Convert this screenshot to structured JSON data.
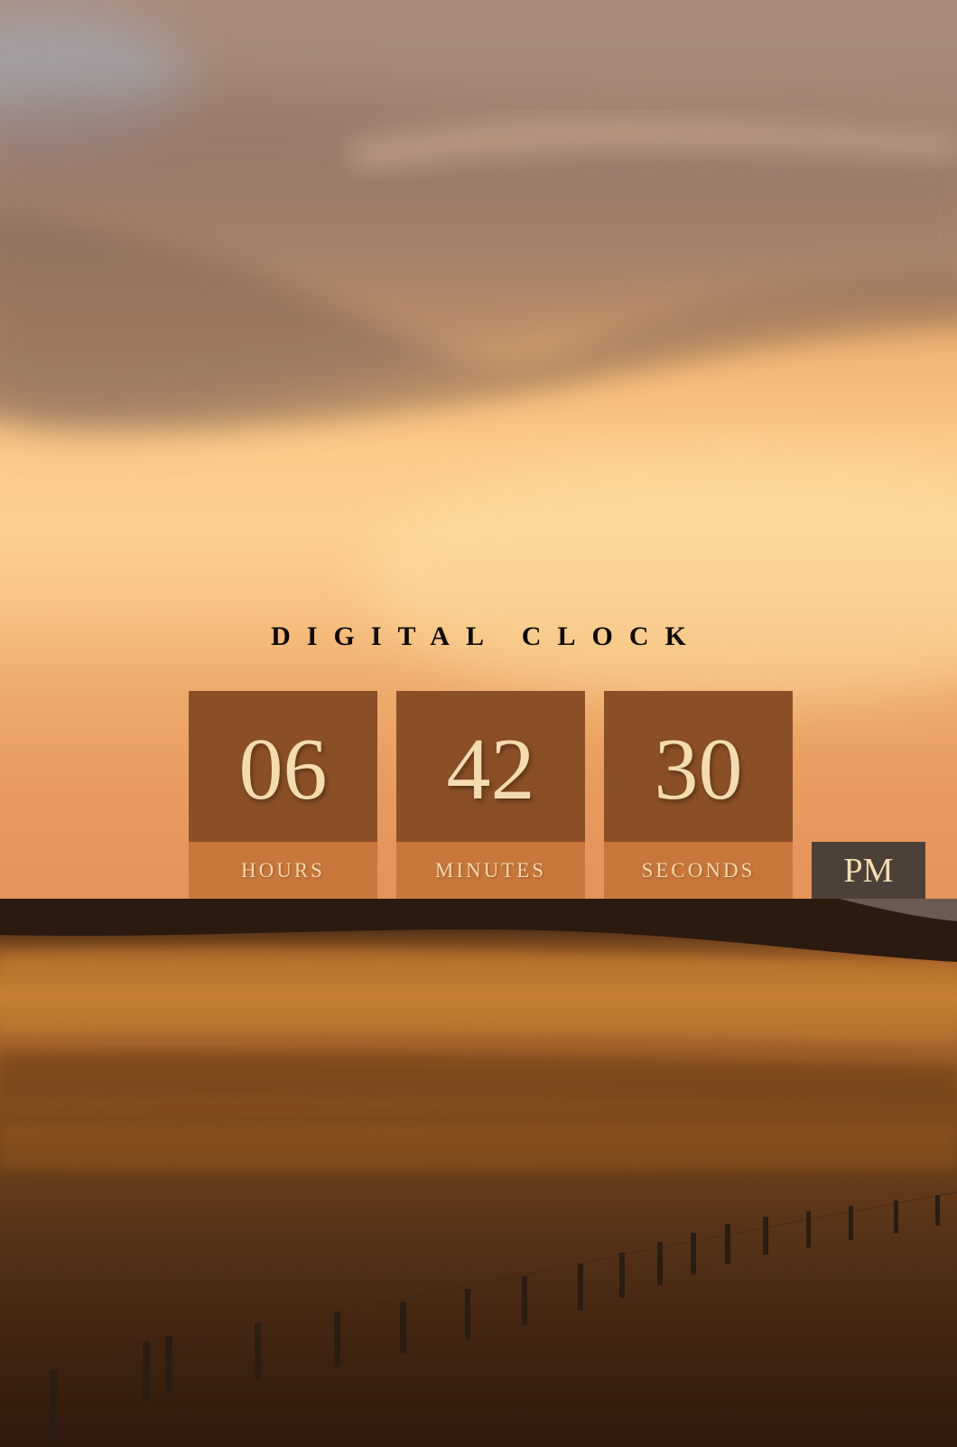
{
  "clock": {
    "title": "DIGITAL CLOCK",
    "hours": {
      "value": "06",
      "label": "HOURS"
    },
    "minutes": {
      "value": "42",
      "label": "MINUTES"
    },
    "seconds": {
      "value": "30",
      "label": "SECONDS"
    },
    "period": "PM"
  },
  "colors": {
    "value_box": "#8a4f26",
    "label_box": "#c8773a",
    "period_box": "#4b4139",
    "digit_text": "#f3dcb0",
    "title_text": "#0d0a08"
  },
  "background": {
    "scene": "sunset-prairie"
  }
}
